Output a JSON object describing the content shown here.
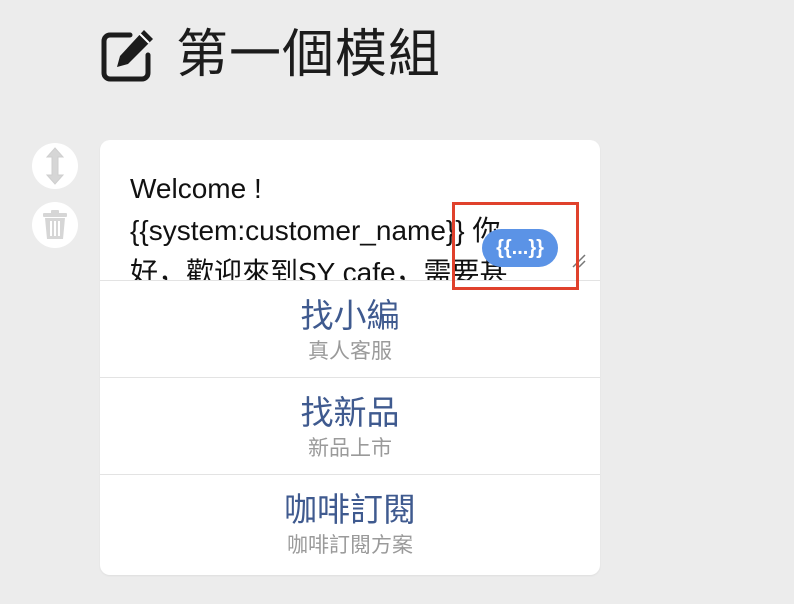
{
  "header": {
    "title": "第一個模組",
    "icon": "edit-icon"
  },
  "side_controls": {
    "move_icon": "vertical-arrows-icon",
    "delete_icon": "trash-icon"
  },
  "message": {
    "lines": [
      "Welcome !",
      "{{system:customer_name}} 你",
      "好，歡迎來到SY cafe，需要甚"
    ],
    "variable_chip": "{{...}}"
  },
  "buttons": [
    {
      "label": "找小編",
      "sublabel": "真人客服"
    },
    {
      "label": "找新品",
      "sublabel": "新品上市"
    },
    {
      "label": "咖啡訂閱",
      "sublabel": "咖啡訂閱方案"
    }
  ],
  "colors": {
    "background": "#ececec",
    "button_text": "#3f5a8f",
    "chip": "#5b93e6",
    "highlight": "#e0412c"
  }
}
